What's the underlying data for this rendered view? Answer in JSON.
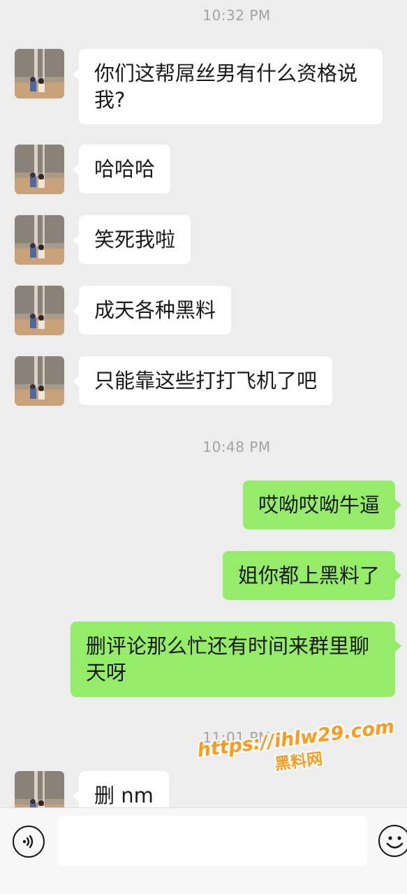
{
  "timestamps": [
    "10:32 PM",
    "10:48 PM",
    "11:01 PM"
  ],
  "messages": [
    {
      "side": "in",
      "text": "你们这帮屌丝男有什么资格说我?"
    },
    {
      "side": "in",
      "text": "哈哈哈"
    },
    {
      "side": "in",
      "text": "笑死我啦"
    },
    {
      "side": "in",
      "text": "成天各种黑料"
    },
    {
      "side": "in",
      "text": "只能靠这些打打飞机了吧"
    },
    {
      "side": "out",
      "text": "哎呦哎呦牛逼"
    },
    {
      "side": "out",
      "text": "姐你都上黑料了"
    },
    {
      "side": "out",
      "text": "删评论那么忙还有时间来群里聊天呀"
    },
    {
      "side": "in",
      "text": "删 nm"
    }
  ],
  "watermark": {
    "url": "https://ihlw29.com",
    "name": "黑料网"
  },
  "input_bar": {
    "voice_icon": "voice-icon",
    "emoji_icon": "emoji-icon",
    "text_value": ""
  },
  "colors": {
    "background": "#ededed",
    "incoming_bubble": "#ffffff",
    "outgoing_bubble": "#95ec69",
    "timestamp_text": "#a3a3a3",
    "watermark": "#ff9a1f"
  }
}
